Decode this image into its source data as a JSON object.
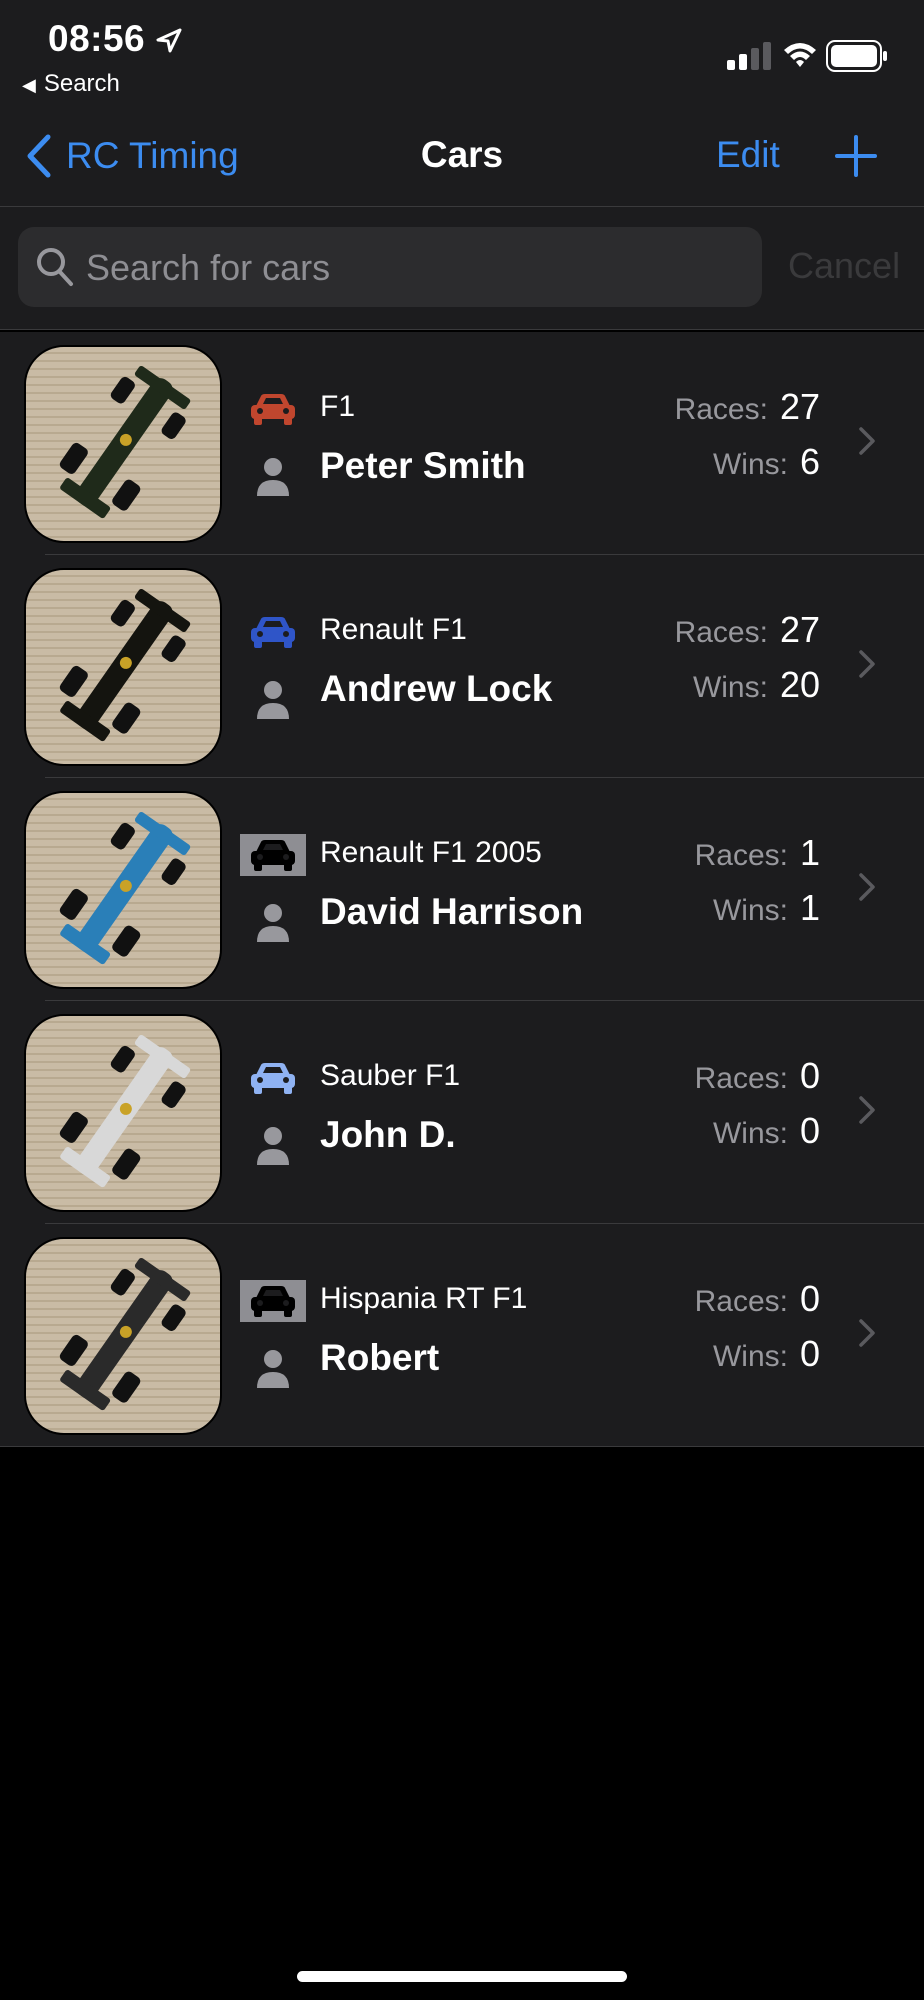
{
  "status_bar": {
    "time": "08:56",
    "back_app": "Search"
  },
  "nav": {
    "back_label": "RC Timing",
    "title": "Cars",
    "edit_label": "Edit"
  },
  "search": {
    "placeholder": "Search for cars",
    "cancel_label": "Cancel"
  },
  "stat_labels": {
    "races": "Races:",
    "wins": "Wins:"
  },
  "cars": [
    {
      "car": "F1",
      "driver": "Peter Smith",
      "races": "27",
      "wins": "6",
      "icon_color": "#c0462e",
      "icon_style": "plain",
      "livery": "#1f2a1a"
    },
    {
      "car": "Renault F1",
      "driver": "Andrew Lock",
      "races": "27",
      "wins": "20",
      "icon_color": "#2f55c8",
      "icon_style": "plain",
      "livery": "#14140f"
    },
    {
      "car": "Renault F1 2005",
      "driver": "David Harrison",
      "races": "1",
      "wins": "1",
      "icon_color": "#000000",
      "icon_style": "boxed",
      "livery": "#2a7fb8"
    },
    {
      "car": "Sauber F1",
      "driver": "John D.",
      "races": "0",
      "wins": "0",
      "icon_color": "#8fb2f2",
      "icon_style": "plain",
      "livery": "#d8d8d8"
    },
    {
      "car": "Hispania RT F1",
      "driver": "Robert",
      "races": "0",
      "wins": "0",
      "icon_color": "#000000",
      "icon_style": "boxed",
      "livery": "#2a2a2a"
    }
  ]
}
